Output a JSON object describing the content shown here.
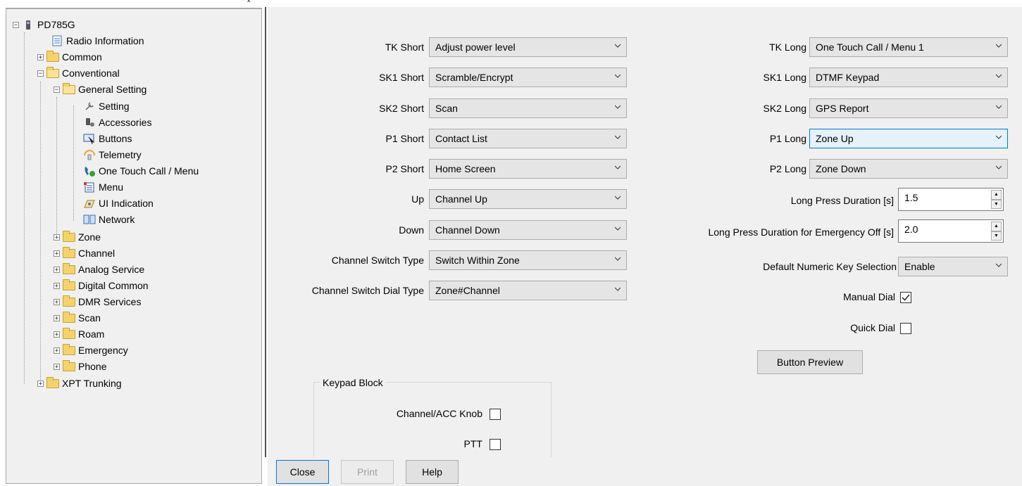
{
  "tree": {
    "root": "PD785G",
    "items": [
      {
        "label": "Radio Information",
        "icon": "info-doc-icon"
      },
      {
        "label": "Common",
        "icon": "folder-icon"
      },
      {
        "label": "Conventional",
        "icon": "folder-open-icon"
      },
      {
        "label": "General Setting",
        "icon": "folder-open-icon"
      },
      {
        "label": "Setting",
        "icon": "wrench-icon"
      },
      {
        "label": "Accessories",
        "icon": "accessories-icon"
      },
      {
        "label": "Buttons",
        "icon": "buttons-icon"
      },
      {
        "label": "Telemetry",
        "icon": "telemetry-icon"
      },
      {
        "label": "One Touch Call / Menu",
        "icon": "phone-call-icon"
      },
      {
        "label": "Menu",
        "icon": "menu-icon"
      },
      {
        "label": "UI Indication",
        "icon": "ui-indication-icon"
      },
      {
        "label": "Network",
        "icon": "network-icon"
      },
      {
        "label": "Zone",
        "icon": "folder-icon"
      },
      {
        "label": "Channel",
        "icon": "folder-icon"
      },
      {
        "label": "Analog Service",
        "icon": "folder-icon"
      },
      {
        "label": "Digital Common",
        "icon": "folder-icon"
      },
      {
        "label": "DMR Services",
        "icon": "folder-icon"
      },
      {
        "label": "Scan",
        "icon": "folder-icon"
      },
      {
        "label": "Roam",
        "icon": "folder-icon"
      },
      {
        "label": "Emergency",
        "icon": "folder-icon"
      },
      {
        "label": "Phone",
        "icon": "folder-icon"
      },
      {
        "label": "XPT Trunking",
        "icon": "folder-icon"
      }
    ]
  },
  "left_fields": [
    {
      "label": "TK Short",
      "value": "Adjust power level"
    },
    {
      "label": "SK1 Short",
      "value": "Scramble/Encrypt"
    },
    {
      "label": "SK2 Short",
      "value": "Scan"
    },
    {
      "label": "P1 Short",
      "value": "Contact List"
    },
    {
      "label": "P2 Short",
      "value": "Home Screen"
    },
    {
      "label": "Up",
      "value": "Channel Up"
    },
    {
      "label": "Down",
      "value": "Channel Down"
    },
    {
      "label": "Channel Switch Type",
      "value": "Switch Within Zone"
    },
    {
      "label": "Channel Switch Dial Type",
      "value": "Zone#Channel"
    }
  ],
  "right_fields": [
    {
      "label": "TK Long",
      "value": "One Touch Call / Menu 1"
    },
    {
      "label": "SK1 Long",
      "value": "DTMF Keypad"
    },
    {
      "label": "SK2 Long",
      "value": "GPS Report"
    },
    {
      "label": "P1 Long",
      "value": "Zone Up"
    },
    {
      "label": "P2 Long",
      "value": "Zone Down"
    }
  ],
  "long_press": {
    "label": "Long Press Duration [s]",
    "value": "1.5"
  },
  "long_press_emergency": {
    "label": "Long Press Duration for Emergency Off [s]",
    "value": "2.0"
  },
  "default_numeric": {
    "label": "Default Numeric Key Selection",
    "value": "Enable"
  },
  "manual_dial": {
    "label": "Manual Dial",
    "checked": true
  },
  "quick_dial": {
    "label": "Quick Dial",
    "checked": false
  },
  "button_preview": "Button Preview",
  "keypad_block": {
    "title": "Keypad Block",
    "channel_knob": {
      "label": "Channel/ACC Knob",
      "checked": false
    },
    "ptt": {
      "label": "PTT",
      "checked": false
    }
  },
  "footer": {
    "close": "Close",
    "print": "Print",
    "help": "Help"
  },
  "colors": {
    "panel_bg": "#f0f0f0",
    "focus_border": "#0078d7",
    "folder": "#f5d36c"
  }
}
